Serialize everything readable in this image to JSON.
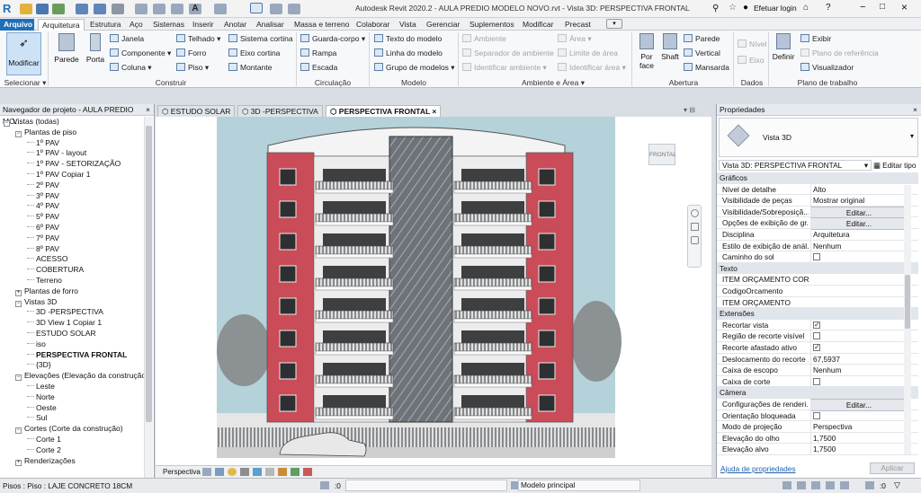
{
  "titlebar": {
    "title": "Autodesk Revit 2020.2 - AULA PREDIO MODELO NOVO.rvt - Vista 3D: PERSPECTIVA FRONTAL",
    "login": "Efetuar login"
  },
  "tabs": [
    "Arquivo",
    "Arquitetura",
    "Estrutura",
    "Aço",
    "Sistemas",
    "Inserir",
    "Anotar",
    "Analisar",
    "Massa e terreno",
    "Colaborar",
    "Vista",
    "Gerenciar",
    "Suplementos",
    "Modificar",
    "Precast"
  ],
  "ribbon": {
    "modify": "Modificar",
    "select": "Selecionar",
    "wall": "Parede",
    "door": "Porta",
    "window": "Janela",
    "component": "Componente",
    "column": "Coluna",
    "roof": "Telhado",
    "ceiling": "Forro",
    "floor": "Piso",
    "curtain_system": "Sistema cortina",
    "curtain_grid": "Eixo cortina",
    "mullion": "Montante",
    "railing": "Guarda-corpo",
    "ramp": "Rampa",
    "stair": "Escada",
    "model_text": "Texto do modelo",
    "model_line": "Linha do modelo",
    "model_group": "Grupo de modelos",
    "room": "Ambiente",
    "room_separator": "Separador de ambiente",
    "tag_room": "Identificar ambiente",
    "area": "Área",
    "area_boundary": "Limite de área",
    "tag_area": "Identificar área",
    "by_face": "Por face",
    "shaft": "Shaft",
    "wall_opening": "Parede",
    "vertical": "Vertical",
    "dormer": "Mansarda",
    "level": "Nível",
    "grid": "Eixo",
    "set": "Definir",
    "show": "Exibir",
    "ref_plane": "Plano de referência",
    "viewer": "Visualizador",
    "groups": {
      "select": "Selecionar",
      "build": "Construir",
      "circulation": "Circulação",
      "model": "Modelo",
      "room_area": "Ambiente e Área",
      "opening": "Abertura",
      "datum": "Dados",
      "work_plane": "Plano de trabalho"
    }
  },
  "browser": {
    "title": "Navegador de projeto - AULA PREDIO MO...",
    "items": [
      {
        "label": "Vistas (todas)",
        "level": 0,
        "exp": "−",
        "bold": false
      },
      {
        "label": "Plantas de piso",
        "level": 1,
        "exp": "−",
        "bold": false
      },
      {
        "label": "1º PAV",
        "level": 2,
        "exp": "",
        "bold": false
      },
      {
        "label": "1º PAV - layout",
        "level": 2,
        "exp": "",
        "bold": false
      },
      {
        "label": "1º PAV - SETORIZAÇÃO",
        "level": 2,
        "exp": "",
        "bold": false
      },
      {
        "label": "1º PAV Copiar 1",
        "level": 2,
        "exp": "",
        "bold": false
      },
      {
        "label": "2º PAV",
        "level": 2,
        "exp": "",
        "bold": false
      },
      {
        "label": "3º PAV",
        "level": 2,
        "exp": "",
        "bold": false
      },
      {
        "label": "4º PAV",
        "level": 2,
        "exp": "",
        "bold": false
      },
      {
        "label": "5º PAV",
        "level": 2,
        "exp": "",
        "bold": false
      },
      {
        "label": "6º PAV",
        "level": 2,
        "exp": "",
        "bold": false
      },
      {
        "label": "7º PAV",
        "level": 2,
        "exp": "",
        "bold": false
      },
      {
        "label": "8º PAV",
        "level": 2,
        "exp": "",
        "bold": false
      },
      {
        "label": "ACESSO",
        "level": 2,
        "exp": "",
        "bold": false
      },
      {
        "label": "COBERTURA",
        "level": 2,
        "exp": "",
        "bold": false
      },
      {
        "label": "Terreno",
        "level": 2,
        "exp": "",
        "bold": false
      },
      {
        "label": "Plantas de forro",
        "level": 1,
        "exp": "+",
        "bold": false
      },
      {
        "label": "Vistas 3D",
        "level": 1,
        "exp": "−",
        "bold": false
      },
      {
        "label": "3D -PERSPECTIVA",
        "level": 2,
        "exp": "",
        "bold": false
      },
      {
        "label": "3D View 1 Copiar 1",
        "level": 2,
        "exp": "",
        "bold": false
      },
      {
        "label": "ESTUDO SOLAR",
        "level": 2,
        "exp": "",
        "bold": false
      },
      {
        "label": "iso",
        "level": 2,
        "exp": "",
        "bold": false
      },
      {
        "label": "PERSPECTIVA FRONTAL",
        "level": 2,
        "exp": "",
        "bold": true
      },
      {
        "label": "{3D}",
        "level": 2,
        "exp": "",
        "bold": false
      },
      {
        "label": "Elevações (Elevação da construção)",
        "level": 1,
        "exp": "−",
        "bold": false
      },
      {
        "label": "Leste",
        "level": 2,
        "exp": "",
        "bold": false
      },
      {
        "label": "Norte",
        "level": 2,
        "exp": "",
        "bold": false
      },
      {
        "label": "Oeste",
        "level": 2,
        "exp": "",
        "bold": false
      },
      {
        "label": "Sul",
        "level": 2,
        "exp": "",
        "bold": false
      },
      {
        "label": "Cortes (Corte da construção)",
        "level": 1,
        "exp": "−",
        "bold": false
      },
      {
        "label": "Corte 1",
        "level": 2,
        "exp": "",
        "bold": false
      },
      {
        "label": "Corte 2",
        "level": 2,
        "exp": "",
        "bold": false
      },
      {
        "label": "Renderizações",
        "level": 1,
        "exp": "+",
        "bold": false
      }
    ]
  },
  "view_tabs": [
    {
      "label": "ESTUDO SOLAR",
      "active": false
    },
    {
      "label": "3D -PERSPECTIVA",
      "active": false
    },
    {
      "label": "PERSPECTIVA FRONTAL",
      "active": true
    }
  ],
  "viewcube_label": "FRONTAL",
  "view_control": {
    "label": "Perspectiva"
  },
  "properties": {
    "title": "Propriedades",
    "type_name": "Vista 3D",
    "instance_selector": "Vista 3D: PERSPECTIVA FRONTAL",
    "edit_type": "Editar tipo",
    "rows": [
      {
        "type": "section",
        "label": "Gráficos"
      },
      {
        "type": "text",
        "key": "Nível de detalhe",
        "value": "Alto"
      },
      {
        "type": "text",
        "key": "Visibilidade de peças",
        "value": "Mostrar original"
      },
      {
        "type": "button",
        "key": "Visibilidade/Sobreposiçã...",
        "value": "Editar..."
      },
      {
        "type": "button",
        "key": "Opções de exibição de gr...",
        "value": "Editar..."
      },
      {
        "type": "text",
        "key": "Disciplina",
        "value": "Arquitetura"
      },
      {
        "type": "text",
        "key": "Estilo de exibição de anál...",
        "value": "Nenhum"
      },
      {
        "type": "check",
        "key": "Caminho do sol",
        "checked": false
      },
      {
        "type": "section",
        "label": "Texto"
      },
      {
        "type": "text",
        "key": "ITEM ORÇAMENTO CORR...",
        "value": ""
      },
      {
        "type": "text",
        "key": "CodigoOrcamento",
        "value": ""
      },
      {
        "type": "text",
        "key": "ITEM ORÇAMENTO",
        "value": ""
      },
      {
        "type": "section",
        "label": "Extensões"
      },
      {
        "type": "check",
        "key": "Recortar vista",
        "checked": true
      },
      {
        "type": "check",
        "key": "Região de recorte visível",
        "checked": false
      },
      {
        "type": "check",
        "key": "Recorte afastado ativo",
        "checked": true
      },
      {
        "type": "text",
        "key": "Deslocamento do recorte ...",
        "value": "67,5937"
      },
      {
        "type": "text",
        "key": "Caixa de escopo",
        "value": "Nenhum"
      },
      {
        "type": "check",
        "key": "Caixa de corte",
        "checked": false
      },
      {
        "type": "section",
        "label": "Câmera"
      },
      {
        "type": "button",
        "key": "Configurações de renderi...",
        "value": "Editar..."
      },
      {
        "type": "check",
        "key": "Orientação bloqueada",
        "checked": false
      },
      {
        "type": "text",
        "key": "Modo de projeção",
        "value": "Perspectiva"
      },
      {
        "type": "text",
        "key": "Elevação do olho",
        "value": "1,7500"
      },
      {
        "type": "text",
        "key": "Elevação alvo",
        "value": "1,7500"
      }
    ],
    "help_link": "Ajuda de propriedades",
    "apply": "Aplicar"
  },
  "status": {
    "left": "Pisos : Piso : LAJE CONCRETO 18CM",
    "zero1": ":0",
    "model": "Modelo principal",
    "zero2": ":0"
  },
  "colors": {
    "accent": "#1e6fb8",
    "brick": "#c94c58",
    "sky": "#b5d1d9"
  }
}
